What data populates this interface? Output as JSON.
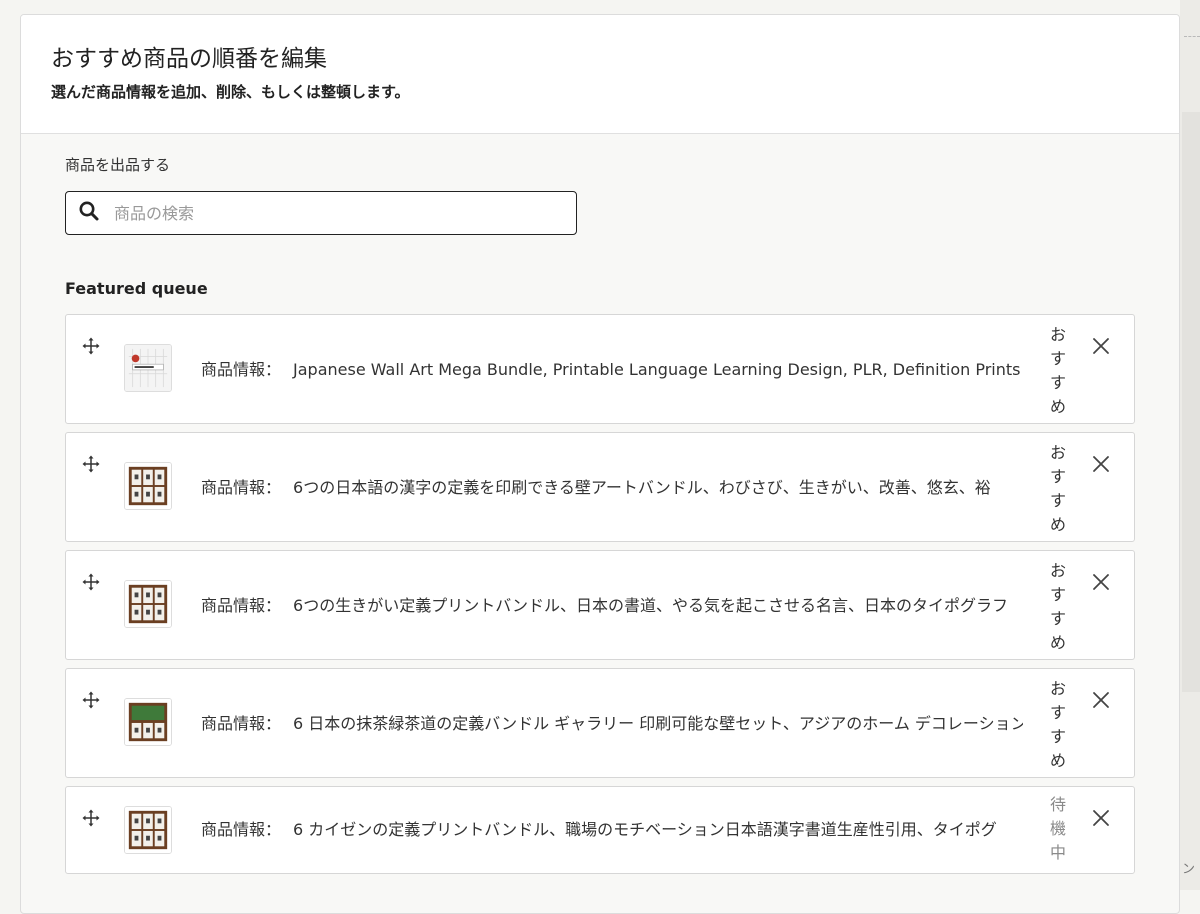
{
  "modal": {
    "title": "おすすめ商品の順番を編集",
    "subtitle": "選んだ商品情報を追加、削除、もしくは整頓します。"
  },
  "search": {
    "label": "商品を出品する",
    "placeholder": "商品の検索",
    "value": ""
  },
  "queue": {
    "title": "Featured queue",
    "items": [
      {
        "prefix": "商品情報：",
        "text": "Japanese Wall Art Mega Bundle, Printable Language Learning Design, PLR, Definition Prints",
        "status": "おすすめ",
        "thumb": "mega-bundle"
      },
      {
        "prefix": "商品情報：",
        "text": "6つの日本語の漢字の定義を印刷できる壁アートバンドル、わびさび、生きがい、改善、悠玄、裕",
        "status": "おすすめ",
        "thumb": "frame-grid"
      },
      {
        "prefix": "商品情報：",
        "text": "6つの生きがい定義プリントバンドル、日本の書道、やる気を起こさせる名言、日本のタイポグラフ",
        "status": "おすすめ",
        "thumb": "frame-grid"
      },
      {
        "prefix": "商品情報：",
        "text": "6 日本の抹茶緑茶道の定義バンドル ギャラリー 印刷可能な壁セット、アジアのホーム デコレーション",
        "status": "おすすめ",
        "thumb": "frame-green"
      },
      {
        "prefix": "商品情報：",
        "text": "6 カイゼンの定義プリントバンドル、職場のモチベーション日本語漢字書道生産性引用、タイポグ",
        "status": "待機中",
        "thumb": "frame-grid"
      }
    ]
  },
  "background": {
    "stub_text": "ン"
  }
}
